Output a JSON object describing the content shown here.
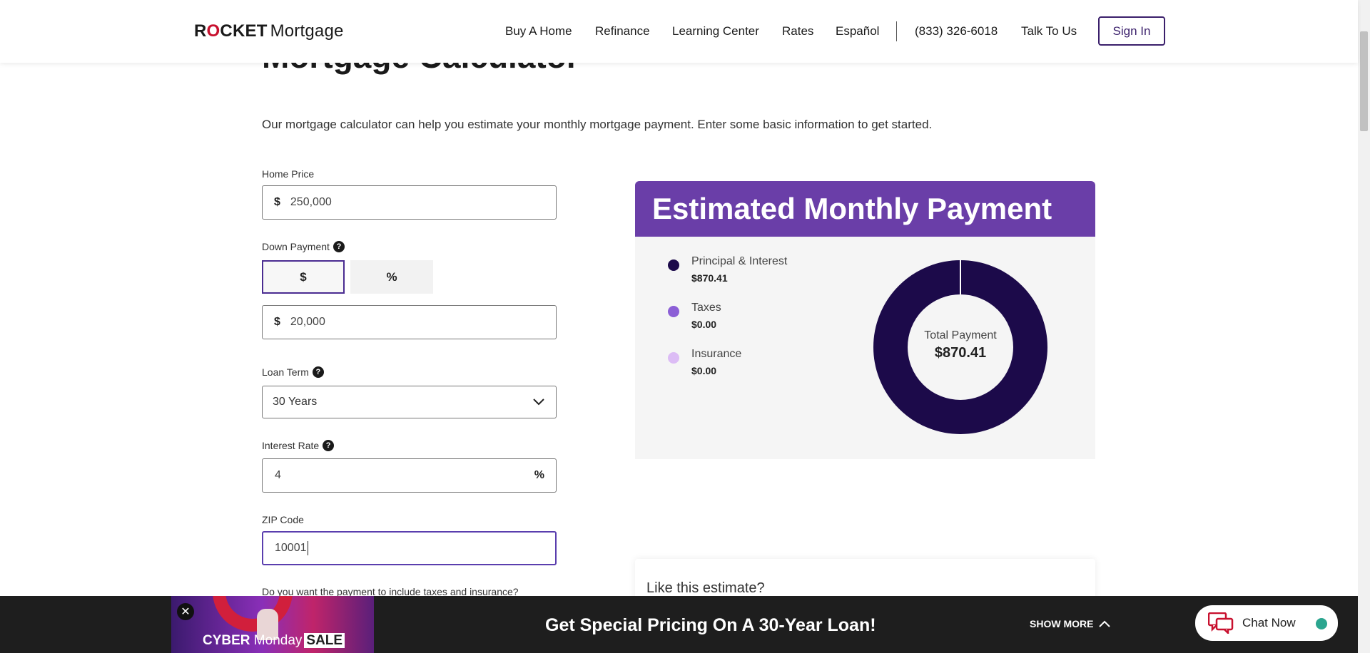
{
  "header": {
    "logo_brand_pre": "R",
    "logo_brand_o": "O",
    "logo_brand_post": "CKET",
    "logo_sub": "Mortgage",
    "nav": [
      "Buy A Home",
      "Refinance",
      "Learning Center",
      "Rates",
      "Español",
      "(833) 326-6018",
      "Talk To Us"
    ],
    "signin": "Sign In"
  },
  "page": {
    "title": "Mortgage Calculator",
    "intro": "Our mortgage calculator can help you estimate your monthly mortgage payment. Enter some basic information to get started."
  },
  "form": {
    "home_price_label": "Home Price",
    "currency_symbol": "$",
    "home_price_value": "250,000",
    "down_payment_label": "Down Payment",
    "help_glyph": "?",
    "toggle_dollar": "$",
    "toggle_percent": "%",
    "down_payment_value": "20,000",
    "loan_term_label": "Loan Term",
    "loan_term_value": "30 Years",
    "interest_rate_label": "Interest Rate",
    "interest_rate_value": "4",
    "percent_symbol": "%",
    "zip_label": "ZIP Code",
    "zip_value": "10001",
    "taxes_question": "Do you want the payment to include taxes and insurance?"
  },
  "result": {
    "heading": "Estimated Monthly Payment",
    "items": [
      {
        "name": "Principal & Interest",
        "value": "$870.41",
        "color": "#1c0a4a"
      },
      {
        "name": "Taxes",
        "value": "$0.00",
        "color": "#8c5fd6"
      },
      {
        "name": "Insurance",
        "value": "$0.00",
        "color": "#dcbcf5"
      }
    ],
    "total_label": "Total Payment",
    "total_value": "$870.41",
    "like_text": "Like this estimate?"
  },
  "chart_data": {
    "type": "pie",
    "categories": [
      "Principal & Interest",
      "Taxes",
      "Insurance"
    ],
    "values": [
      870.41,
      0,
      0
    ],
    "title": ""
  },
  "banner": {
    "promo_word1": "CYBER",
    "promo_word2": "Monday",
    "promo_word3": "SALE",
    "close_glyph": "✕",
    "headline": "Get Special Pricing On A 30-Year Loan!",
    "show_more": "SHOW MORE",
    "chat": "Chat Now"
  },
  "colors": {
    "brand_purple": "#6a3ea8",
    "dark_purple": "#1c0a4a",
    "accent_red": "#c8102e",
    "chat_online": "#2ba58f"
  }
}
